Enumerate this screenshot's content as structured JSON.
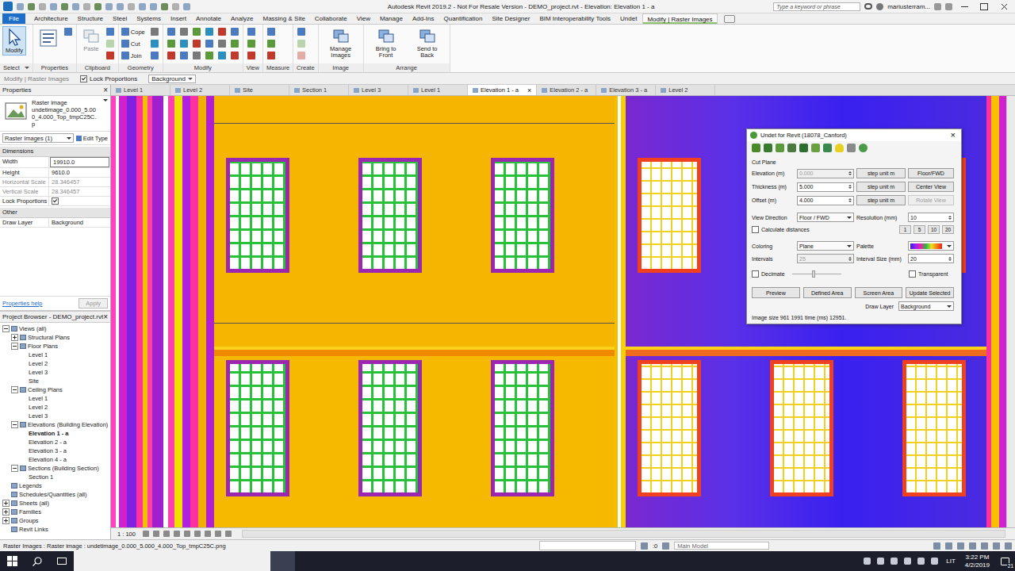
{
  "window": {
    "title": "Autodesk Revit 2019.2 - Not For Resale Version - DEMO_project.rvt - Elevation: Elevation 1 - a"
  },
  "search": {
    "placeholder": "Type a keyword or phrase"
  },
  "user": {
    "name": "mariusterram..."
  },
  "menu_tabs": [
    {
      "label": "File",
      "kind": "file",
      "selected": false
    },
    {
      "label": "Architecture",
      "kind": "tab",
      "selected": false
    },
    {
      "label": "Structure",
      "kind": "tab",
      "selected": false
    },
    {
      "label": "Steel",
      "kind": "tab",
      "selected": false
    },
    {
      "label": "Systems",
      "kind": "tab",
      "selected": false
    },
    {
      "label": "Insert",
      "kind": "tab",
      "selected": false
    },
    {
      "label": "Annotate",
      "kind": "tab",
      "selected": false
    },
    {
      "label": "Analyze",
      "kind": "tab",
      "selected": false
    },
    {
      "label": "Massing & Site",
      "kind": "tab",
      "selected": false
    },
    {
      "label": "Collaborate",
      "kind": "tab",
      "selected": false
    },
    {
      "label": "View",
      "kind": "tab",
      "selected": false
    },
    {
      "label": "Manage",
      "kind": "tab",
      "selected": false
    },
    {
      "label": "Add-Ins",
      "kind": "tab",
      "selected": false
    },
    {
      "label": "Quantification",
      "kind": "tab",
      "selected": false
    },
    {
      "label": "Site Designer",
      "kind": "tab",
      "selected": false
    },
    {
      "label": "BIM Interoperability Tools",
      "kind": "tab",
      "selected": false
    },
    {
      "label": "Undet",
      "kind": "tab",
      "selected": false
    },
    {
      "label": "Modify | Raster Images",
      "kind": "tab",
      "selected": true
    }
  ],
  "ribbon": {
    "panels": [
      {
        "label": "Select",
        "dropdown": true,
        "tools": [
          {
            "kind": "large",
            "label": "Modify",
            "selected": true,
            "disabled": false
          }
        ]
      },
      {
        "label": "Properties",
        "dropdown": false,
        "tools": [
          {
            "kind": "bigicon",
            "selected": false,
            "disabled": false
          },
          {
            "kind": "icon",
            "selected": false,
            "disabled": false
          }
        ]
      },
      {
        "label": "Clipboard",
        "dropdown": false,
        "tools": [
          {
            "kind": "large",
            "label": "Paste",
            "selected": false,
            "disabled": true
          },
          {
            "kind": "icon",
            "selected": false,
            "disabled": false
          },
          {
            "kind": "icon",
            "selected": false,
            "disabled": true
          },
          {
            "kind": "icon",
            "selected": false,
            "disabled": false
          }
        ]
      },
      {
        "label": "Geometry",
        "dropdown": false,
        "tools": [
          {
            "kind": "small",
            "label": "Cope",
            "selected": false,
            "disabled": false
          },
          {
            "kind": "small",
            "label": "Cut",
            "selected": false,
            "disabled": false
          },
          {
            "kind": "small",
            "label": "Join",
            "selected": false,
            "disabled": false
          },
          {
            "kind": "icon",
            "selected": false,
            "disabled": false
          },
          {
            "kind": "icon",
            "selected": false,
            "disabled": false
          },
          {
            "kind": "icon",
            "selected": false,
            "disabled": false
          }
        ]
      },
      {
        "label": "Modify",
        "dropdown": false,
        "tools": [
          {
            "kind": "icon",
            "selected": false,
            "disabled": false
          },
          {
            "kind": "icon",
            "selected": false,
            "disabled": false
          },
          {
            "kind": "icon",
            "selected": false,
            "disabled": false
          },
          {
            "kind": "icon",
            "selected": false,
            "disabled": false
          },
          {
            "kind": "icon",
            "selected": false,
            "disabled": false
          },
          {
            "kind": "icon",
            "selected": false,
            "disabled": false
          },
          {
            "kind": "icon",
            "selected": false,
            "disabled": false
          },
          {
            "kind": "icon",
            "selected": false,
            "disabled": false
          },
          {
            "kind": "icon",
            "selected": false,
            "disabled": false
          },
          {
            "kind": "icon",
            "selected": false,
            "disabled": false
          },
          {
            "kind": "icon",
            "selected": false,
            "disabled": false
          },
          {
            "kind": "icon",
            "selected": false,
            "disabled": false
          },
          {
            "kind": "icon",
            "selected": false,
            "disabled": false
          },
          {
            "kind": "icon",
            "selected": false,
            "disabled": false
          },
          {
            "kind": "icon",
            "selected": false,
            "disabled": false
          },
          {
            "kind": "icon",
            "selected": false,
            "disabled": false
          },
          {
            "kind": "icon",
            "selected": false,
            "disabled": false
          },
          {
            "kind": "icon",
            "selected": false,
            "disabled": false
          }
        ]
      },
      {
        "label": "View",
        "dropdown": false,
        "tools": [
          {
            "kind": "icon",
            "selected": false,
            "disabled": false
          },
          {
            "kind": "icon",
            "selected": false,
            "disabled": false
          },
          {
            "kind": "icon",
            "selected": false,
            "disabled": false
          }
        ]
      },
      {
        "label": "Measure",
        "dropdown": false,
        "tools": [
          {
            "kind": "icon",
            "selected": false,
            "disabled": false
          },
          {
            "kind": "icon",
            "selected": false,
            "disabled": false
          },
          {
            "kind": "icon",
            "selected": false,
            "disabled": false
          }
        ]
      },
      {
        "label": "Create",
        "dropdown": false,
        "tools": [
          {
            "kind": "icon",
            "selected": false,
            "disabled": false
          },
          {
            "kind": "icon",
            "selected": false,
            "disabled": true
          },
          {
            "kind": "icon",
            "selected": false,
            "disabled": true
          }
        ]
      },
      {
        "label": "Image",
        "dropdown": false,
        "tools": [
          {
            "kind": "large",
            "label": "Manage Images",
            "selected": false,
            "disabled": false
          }
        ]
      },
      {
        "label": "Arrange",
        "dropdown": false,
        "tools": [
          {
            "kind": "large",
            "label": "Bring to Front",
            "selected": false,
            "disabled": false
          },
          {
            "kind": "large",
            "label": "Send to Back",
            "selected": false,
            "disabled": false
          }
        ]
      }
    ]
  },
  "options_bar": {
    "context": "Modify | Raster Images",
    "lock_proportions": {
      "label": "Lock Proportions",
      "checked": true
    },
    "draw_layer": "Background"
  },
  "properties": {
    "title": "Properties",
    "close": "×",
    "type_name": "Raster image",
    "type_file": "undetimage_0.000_5.000_4.000_Top_tmpC25C.p",
    "instance": "Raster Images (1)",
    "edit_type": "Edit Type",
    "groups": [
      {
        "label": "Dimensions",
        "rows": [
          {
            "label": "Width",
            "kind": "input",
            "value": "19910.0",
            "disabled": false
          },
          {
            "label": "Height",
            "kind": "text",
            "value": "9610.0",
            "disabled": false
          },
          {
            "label": "Horizontal Scale",
            "kind": "text",
            "value": "28.346457",
            "disabled": true
          },
          {
            "label": "Vertical Scale",
            "kind": "text",
            "value": "28.346457",
            "disabled": true
          },
          {
            "label": "Lock Proportions",
            "kind": "checkbox",
            "checked": true,
            "disabled": false
          }
        ]
      },
      {
        "label": "Other",
        "rows": [
          {
            "label": "Draw Layer",
            "kind": "text",
            "value": "Background",
            "disabled": false
          }
        ]
      }
    ],
    "help": "Properties help",
    "apply": {
      "label": "Apply",
      "disabled": true
    }
  },
  "project_browser": {
    "title": "Project Browser - DEMO_project.rvt",
    "close": "×",
    "items": [
      {
        "label": "Views (all)",
        "depth": 0,
        "expandable": true,
        "expanded": true,
        "selected": false
      },
      {
        "label": "Structural Plans",
        "depth": 1,
        "expandable": true,
        "expanded": false,
        "selected": false
      },
      {
        "label": "Floor Plans",
        "depth": 1,
        "expandable": true,
        "expanded": true,
        "selected": false
      },
      {
        "label": "Level 1",
        "depth": 2,
        "expandable": false,
        "expanded": false,
        "selected": false
      },
      {
        "label": "Level 2",
        "depth": 2,
        "expandable": false,
        "expanded": false,
        "selected": false
      },
      {
        "label": "Level 3",
        "depth": 2,
        "expandable": false,
        "expanded": false,
        "selected": false
      },
      {
        "label": "Site",
        "depth": 2,
        "expandable": false,
        "expanded": false,
        "selected": false
      },
      {
        "label": "Ceiling Plans",
        "depth": 1,
        "expandable": true,
        "expanded": true,
        "selected": false
      },
      {
        "label": "Level 1",
        "depth": 2,
        "expandable": false,
        "expanded": false,
        "selected": false
      },
      {
        "label": "Level 2",
        "depth": 2,
        "expandable": false,
        "expanded": false,
        "selected": false
      },
      {
        "label": "Level 3",
        "depth": 2,
        "expandable": false,
        "expanded": false,
        "selected": false
      },
      {
        "label": "Elevations (Building Elevation)",
        "depth": 1,
        "expandable": true,
        "expanded": true,
        "selected": false
      },
      {
        "label": "Elevation 1 - a",
        "depth": 2,
        "expandable": false,
        "expanded": false,
        "selected": true
      },
      {
        "label": "Elevation 2 - a",
        "depth": 2,
        "expandable": false,
        "expanded": false,
        "selected": false
      },
      {
        "label": "Elevation 3 - a",
        "depth": 2,
        "expandable": false,
        "expanded": false,
        "selected": false
      },
      {
        "label": "Elevation 4 - a",
        "depth": 2,
        "expandable": false,
        "expanded": false,
        "selected": false
      },
      {
        "label": "Sections (Building Section)",
        "depth": 1,
        "expandable": true,
        "expanded": true,
        "selected": false
      },
      {
        "label": "Section 1",
        "depth": 2,
        "expandable": false,
        "expanded": false,
        "selected": false
      },
      {
        "label": "Legends",
        "depth": 0,
        "expandable": false,
        "expanded": false,
        "selected": false
      },
      {
        "label": "Schedules/Quantities (all)",
        "depth": 0,
        "expandable": false,
        "expanded": false,
        "selected": false
      },
      {
        "label": "Sheets (all)",
        "depth": 0,
        "expandable": true,
        "expanded": false,
        "selected": false
      },
      {
        "label": "Families",
        "depth": 0,
        "expandable": true,
        "expanded": false,
        "selected": false
      },
      {
        "label": "Groups",
        "depth": 0,
        "expandable": true,
        "expanded": false,
        "selected": false
      },
      {
        "label": "Revit Links",
        "depth": 0,
        "expandable": false,
        "expanded": false,
        "selected": false
      }
    ]
  },
  "view_tabs": {
    "close": "×",
    "items": [
      {
        "label": "Level 1",
        "selected": false
      },
      {
        "label": "Level 2",
        "selected": false
      },
      {
        "label": "Site",
        "selected": false
      },
      {
        "label": "Section 1",
        "selected": false
      },
      {
        "label": "Level 3",
        "selected": false
      },
      {
        "label": "Level 1",
        "selected": false
      },
      {
        "label": "Elevation 1 - a",
        "selected": true
      },
      {
        "label": "Elevation 2 - a",
        "selected": false
      },
      {
        "label": "Elevation 3 - a",
        "selected": false
      },
      {
        "label": "Level 2",
        "selected": false
      }
    ]
  },
  "undet": {
    "title": "Undet for Revit (18078_Canford)",
    "close": "×",
    "toolbar": [
      {
        "color": "#4a8a2a"
      },
      {
        "color": "#3a7a30"
      },
      {
        "color": "#5a9a3a"
      },
      {
        "color": "#4a7a40"
      },
      {
        "color": "#2e6e2e"
      },
      {
        "color": "#6aa040"
      },
      {
        "color": "#3a8a50"
      },
      {
        "color": "#e8d020"
      },
      {
        "color": "#8a8a8a"
      },
      {
        "color": "#4a9a4a"
      }
    ],
    "section": "Cut Plane",
    "fields": [
      {
        "label": "Elevation (m)",
        "value": "0.000",
        "disabled": true,
        "step": "step unit m",
        "action": {
          "label": "Floor/FWD",
          "disabled": false
        }
      },
      {
        "label": "Thickness (m)",
        "value": "5.000",
        "disabled": false,
        "step": "step unit m",
        "action": {
          "label": "Center View",
          "disabled": false
        }
      },
      {
        "label": "Offset (m)",
        "value": "4.000",
        "disabled": false,
        "step": "step unit m",
        "action": {
          "label": "Rotate View",
          "disabled": true
        }
      }
    ],
    "view_direction": {
      "label": "View Direction",
      "value": "Floor / FWD"
    },
    "resolution": {
      "label": "Resolution (mm)",
      "value": "10"
    },
    "calculate": {
      "label": "Calculate distances",
      "checked": false
    },
    "quick": [
      "1",
      "5",
      "10",
      "20"
    ],
    "coloring": {
      "label": "Coloring",
      "value": "Plane"
    },
    "palette": {
      "label": "Palette"
    },
    "intervals": {
      "label": "Intervals",
      "value": "25",
      "disabled": true
    },
    "interval_size": {
      "label": "Interval Size (mm)",
      "value": "20"
    },
    "decimate": {
      "label": "Decimate",
      "checked": false,
      "level": 0.45
    },
    "transparent": {
      "label": "Transparent",
      "checked": false
    },
    "buttons": [
      "Preview",
      "Defined Area",
      "Screen Area",
      "Update Selected"
    ],
    "draw_layer": {
      "label": "Draw Layer",
      "value": "Background"
    },
    "status": "Image size 961 1991 time (ms) 12951."
  },
  "view_control": {
    "scale": "1 : 100"
  },
  "status_bar": {
    "text": "Raster Images : Raster image : undetimage_0.000_5.000_4.000_Top_tmpC25C.png",
    "workset": ":0",
    "model": "Main Model"
  },
  "taskbar": {
    "apps": [
      {
        "kind": "chrome",
        "active": false
      },
      {
        "kind": "folder",
        "active": false
      },
      {
        "kind": "calendar",
        "active": false
      },
      {
        "kind": "letter",
        "glyph": "O",
        "color": "#0f6cbd",
        "active": false
      },
      {
        "kind": "letter",
        "glyph": "S",
        "color": "#00aff0",
        "active": false
      },
      {
        "kind": "letter",
        "glyph": "P",
        "color": "#c43e1c",
        "active": false
      },
      {
        "kind": "letter",
        "glyph": "W",
        "color": "#2b579a",
        "active": false
      },
      {
        "kind": "chrome",
        "active": false
      },
      {
        "kind": "letter",
        "glyph": "R",
        "color": "#1d6fb8",
        "active": true
      }
    ],
    "lang": "LIT",
    "time": "3:22 PM",
    "date": "4/2/2019",
    "notifications": "21"
  }
}
